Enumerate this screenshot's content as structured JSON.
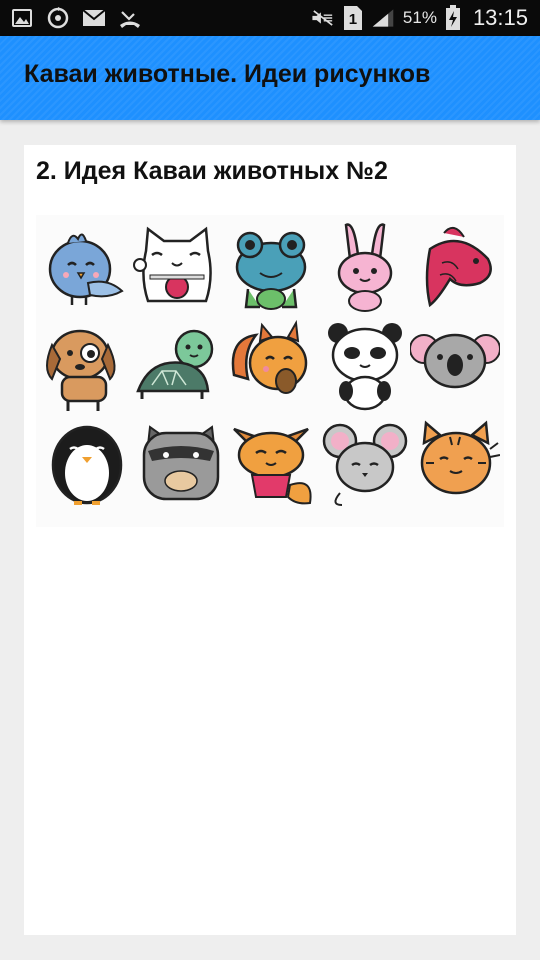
{
  "status_bar": {
    "icons_left": [
      "gallery-icon",
      "sync-icon",
      "mail-icon",
      "missed-call-icon"
    ],
    "icons_right": [
      "mute-icon",
      "sim-1-icon",
      "signal-icon",
      "battery-charging-icon"
    ],
    "sim_label": "1",
    "battery": "51%",
    "time": "13:15"
  },
  "app_bar": {
    "title": "Каваи животные. Идеи рисунков",
    "color": "#1e90ff"
  },
  "content": {
    "heading": "2. Идея Каваи животных №2",
    "illustration": {
      "animals": [
        "bird",
        "lucky-cat",
        "frog",
        "bunny",
        "koi-fish",
        "puppy",
        "turtle",
        "squirrel",
        "panda",
        "koala",
        "penguin",
        "raccoon",
        "fox",
        "mouse",
        "tiger-cat"
      ]
    }
  }
}
